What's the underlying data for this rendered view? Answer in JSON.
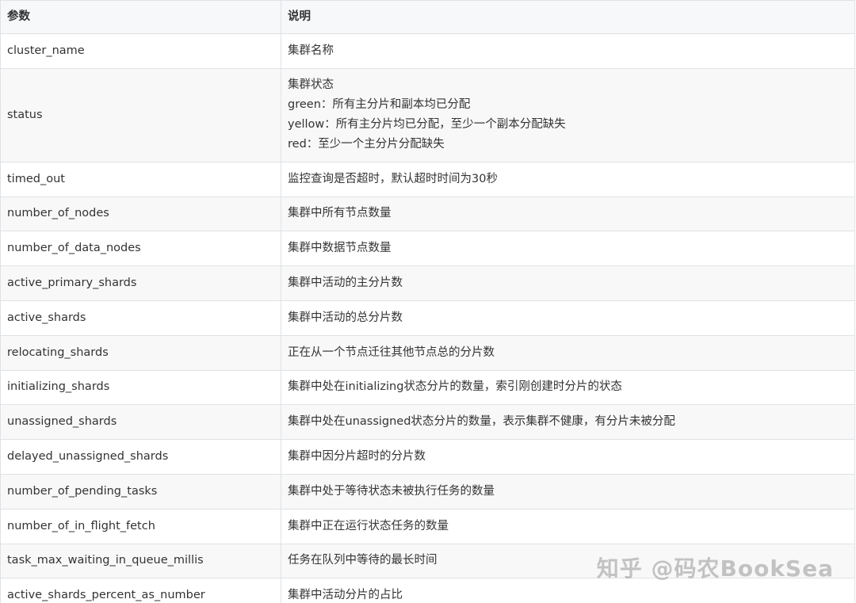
{
  "table": {
    "headers": [
      "参数",
      "说明"
    ],
    "rows": [
      {
        "param": "cluster_name",
        "desc": [
          "集群名称"
        ]
      },
      {
        "param": "status",
        "desc": [
          "集群状态",
          "green：所有主分片和副本均已分配",
          "yellow：所有主分片均已分配，至少一个副本分配缺失",
          "red：至少一个主分片分配缺失"
        ]
      },
      {
        "param": "timed_out",
        "desc": [
          "监控查询是否超时，默认超时时间为30秒"
        ]
      },
      {
        "param": "number_of_nodes",
        "desc": [
          "集群中所有节点数量"
        ]
      },
      {
        "param": "number_of_data_nodes",
        "desc": [
          "集群中数据节点数量"
        ]
      },
      {
        "param": "active_primary_shards",
        "desc": [
          "集群中活动的主分片数"
        ]
      },
      {
        "param": "active_shards",
        "desc": [
          "集群中活动的总分片数"
        ]
      },
      {
        "param": "relocating_shards",
        "desc": [
          "正在从一个节点迁往其他节点总的分片数"
        ]
      },
      {
        "param": "initializing_shards",
        "desc": [
          "集群中处在initializing状态分片的数量，索引刚创建时分片的状态"
        ]
      },
      {
        "param": "unassigned_shards",
        "desc": [
          "集群中处在unassigned状态分片的数量，表示集群不健康，有分片未被分配"
        ]
      },
      {
        "param": "delayed_unassigned_shards",
        "desc": [
          "集群中因分片超时的分片数"
        ]
      },
      {
        "param": "number_of_pending_tasks",
        "desc": [
          "集群中处于等待状态未被执行任务的数量"
        ]
      },
      {
        "param": "number_of_in_flight_fetch",
        "desc": [
          "集群中正在运行状态任务的数量"
        ]
      },
      {
        "param": "task_max_waiting_in_queue_millis",
        "desc": [
          "任务在队列中等待的最长时间"
        ]
      },
      {
        "param": "active_shards_percent_as_number",
        "desc": [
          "集群中活动分片的占比"
        ]
      }
    ]
  },
  "watermark": "知乎 @码农BookSea"
}
